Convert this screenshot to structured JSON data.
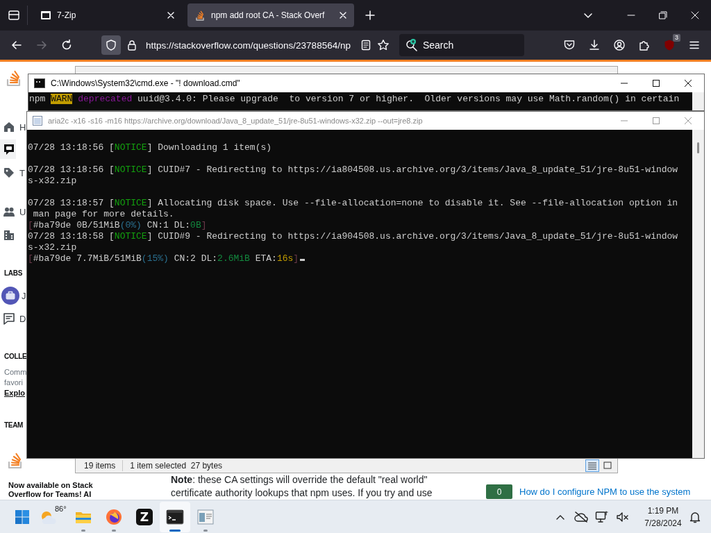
{
  "browser": {
    "tabs": [
      {
        "title": "7-Zip",
        "selected": false
      },
      {
        "title": "npm add root CA - Stack Overf",
        "selected": true
      }
    ],
    "nav_buttons": [
      {
        "kind": "back",
        "disabled": false
      },
      {
        "kind": "forward",
        "disabled": true
      },
      {
        "kind": "reload",
        "disabled": false
      }
    ],
    "address": "https://stackoverflow.com/questions/23788564/np",
    "search": {
      "placeholder": "Search"
    },
    "extension_badge": "3"
  },
  "page": {
    "sidebar": {
      "nav": [
        {
          "kind": "home",
          "label": "H",
          "selected": false
        },
        {
          "kind": "questions",
          "selected": true
        },
        {
          "kind": "tags",
          "label": "T",
          "selected": false
        },
        {
          "kind": "users",
          "label": "U",
          "selected": false
        },
        {
          "kind": "companies",
          "selected": false
        }
      ],
      "labs": {
        "heading": "LABS",
        "items": [
          {
            "kind": "jobs",
            "label": "J",
            "selected": false
          },
          {
            "kind": "discussions",
            "label": "D",
            "selected": false
          }
        ]
      },
      "collectives": {
        "heading": "COLLE",
        "text": [
          "Comm",
          "favori"
        ],
        "link": "Explo"
      },
      "teams": {
        "heading": "TEAM",
        "promo": "Now available on Stack Overflow for Teams! AI"
      }
    },
    "answer_lines": [
      "**Note**: these CA settings will override the default \"real world\"",
      "certificate authority lookups that npm uses. If you try and use"
    ],
    "related": [
      {
        "score": "0",
        "title": "How do I configure NPM to use the system"
      }
    ]
  },
  "zip_window": {
    "status": [
      "19 items",
      "1 item selected  27 bytes"
    ],
    "views": [
      {
        "kind": "details",
        "selected": true
      },
      {
        "kind": "icons",
        "selected": false
      }
    ]
  },
  "consoles": [
    {
      "title": "C:\\Windows\\System32\\cmd.exe - \"! download.cmd\"",
      "active": true,
      "cursor": false,
      "blocks": [
        {
          "lines": [
            [
              {
                "text": "npm ",
                "color": "#cccccc"
              },
              {
                "text": "WARN",
                "color": "#c19c00",
                "kind": "highlight"
              },
              {
                "text": " deprecated",
                "color": "#881798"
              },
              {
                "text": " uuid@3.4.0: Please upgrade  to version 7 or higher.  Older versions may use Math.random() in certain",
                "color": "#cccccc"
              }
            ]
          ]
        }
      ]
    },
    {
      "title": "aria2c -x16 -s16 -m16 https://archive.org/download/Java_8_update_51/jre-8u51-windows-x32.zip --out=jre8.zip",
      "active": false,
      "cursor": true,
      "blocks": [
        {
          "lines": [
            [
              {
                "text": "07/28 13:18:56 [",
                "color": "#cccccc"
              },
              {
                "text": "NOTICE",
                "color": "#13a10e"
              },
              {
                "text": "] Downloading 1 item(s)",
                "color": "#cccccc"
              }
            ]
          ]
        },
        {
          "lines": [
            [
              {
                "text": "07/28 13:18:56 [",
                "color": "#cccccc"
              },
              {
                "text": "NOTICE",
                "color": "#13a10e"
              },
              {
                "text": "] CUID#7 - Redirecting to https://ia804508.us.archive.org/3/items/Java_8_update_51/jre-8u51-window",
                "color": "#cccccc"
              }
            ],
            [
              {
                "text": "s-x32.zip",
                "color": "#cccccc"
              }
            ]
          ]
        },
        {
          "lines": [
            [
              {
                "text": "07/28 13:18:57 [",
                "color": "#cccccc"
              },
              {
                "text": "NOTICE",
                "color": "#13a10e"
              },
              {
                "text": "] Allocating disk space. Use --file-allocation=none to disable it. See --file-allocation option in",
                "color": "#cccccc"
              }
            ],
            [
              {
                "text": " man page for more details.",
                "color": "#cccccc"
              }
            ],
            [
              {
                "text": "[",
                "color": "#6b3a4a"
              },
              {
                "text": "#ba79de 0B/51MiB",
                "color": "#cccccc"
              },
              {
                "text": "(0%)",
                "color": "#2a6f8f"
              },
              {
                "text": " CN:1 DL:",
                "color": "#cccccc"
              },
              {
                "text": "0B",
                "color": "#138a3f"
              },
              {
                "text": "]",
                "color": "#6b3a4a"
              }
            ],
            [
              {
                "text": "07/28 13:18:58 [",
                "color": "#cccccc"
              },
              {
                "text": "NOTICE",
                "color": "#13a10e"
              },
              {
                "text": "] CUID#9 - Redirecting to https://ia904508.us.archive.org/3/items/Java_8_update_51/jre-8u51-window",
                "color": "#cccccc"
              }
            ],
            [
              {
                "text": "s-x32.zip",
                "color": "#cccccc"
              }
            ],
            [
              {
                "text": "[",
                "color": "#6b3a4a"
              },
              {
                "text": "#ba79de 7.7MiB/51MiB",
                "color": "#cccccc"
              },
              {
                "text": "(15%)",
                "color": "#2a6f8f"
              },
              {
                "text": " CN:2 DL:",
                "color": "#cccccc"
              },
              {
                "text": "2.6MiB",
                "color": "#138a3f"
              },
              {
                "text": " ETA:",
                "color": "#cccccc"
              },
              {
                "text": "16s",
                "color": "#c19c00"
              },
              {
                "text": "]",
                "color": "#6b3a4a"
              }
            ]
          ]
        }
      ]
    }
  ],
  "taskbar": {
    "apps": [
      {
        "kind": "start",
        "selected": false,
        "running": false
      },
      {
        "kind": "weather",
        "label": "86°",
        "selected": false,
        "running": false
      },
      {
        "kind": "files",
        "selected": false,
        "running": true
      },
      {
        "kind": "browser",
        "selected": false,
        "running": true
      },
      {
        "kind": "letter",
        "label": "Z",
        "selected": false,
        "running": false
      },
      {
        "kind": "terminal",
        "selected": true,
        "running": true
      },
      {
        "kind": "archiver",
        "selected": false,
        "running": true
      }
    ],
    "clock": {
      "time": "1:19 PM",
      "date": "7/28/2024"
    }
  }
}
